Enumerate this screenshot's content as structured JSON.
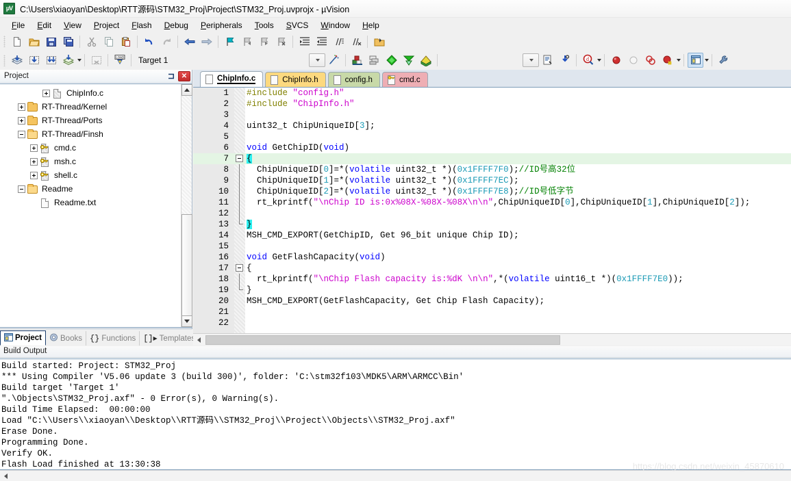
{
  "window": {
    "title": "C:\\Users\\xiaoyan\\Desktop\\RTT源码\\STM32_Proj\\Project\\STM32_Proj.uvprojx - µVision",
    "logo_text": "µV"
  },
  "menubar": {
    "items": [
      {
        "label": "File"
      },
      {
        "label": "Edit"
      },
      {
        "label": "View"
      },
      {
        "label": "Project"
      },
      {
        "label": "Flash"
      },
      {
        "label": "Debug"
      },
      {
        "label": "Peripherals"
      },
      {
        "label": "Tools"
      },
      {
        "label": "SVCS"
      },
      {
        "label": "Window"
      },
      {
        "label": "Help"
      }
    ]
  },
  "toolbar": {
    "target_value": "Target 1",
    "buttons_row1": [
      "new-file-icon",
      "open-file-icon",
      "save-icon",
      "save-all-icon",
      "cut-icon",
      "copy-icon",
      "paste-icon",
      "undo-icon",
      "redo-icon",
      "navigate-back-icon",
      "navigate-forward-icon",
      "bookmark-toggle-icon",
      "bookmark-prev-icon",
      "bookmark-next-icon",
      "bookmark-clear-icon",
      "indent-right-icon",
      "indent-left-icon",
      "comment-icon",
      "uncomment-icon",
      "open-file-folder-icon"
    ],
    "buttons_row2": [
      "translate-icon",
      "build-icon",
      "rebuild-icon",
      "batch-build-icon",
      "stop-build-icon",
      "download-icon"
    ],
    "buttons_row2b": [
      "target-options-icon",
      "manage-components-icon",
      "multi-project-icon",
      "pack-installer-icon",
      "configuration-wizard-icon",
      "pack-manager-icon"
    ],
    "buttons_row3": [
      "insert-bookmark-icon",
      "start-debug-icon",
      "find-in-files-icon",
      "insert-breakpoint-icon",
      "disable-breakpoint-icon",
      "kill-breakpoints-icon",
      "disable-all-breakpoints-icon",
      "window-layout-icon",
      "settings-wrench-icon"
    ]
  },
  "project_panel": {
    "title": "Project",
    "pin_icon": "pin-icon",
    "close_icon": "close-icon",
    "tree": [
      {
        "label": "ChipInfo.c",
        "indent": 3,
        "expander": "plus",
        "icon": "file-hatch"
      },
      {
        "label": "RT-Thread/Kernel",
        "indent": 1,
        "expander": "plus",
        "icon": "folder"
      },
      {
        "label": "RT-Thread/Ports",
        "indent": 1,
        "expander": "plus",
        "icon": "folder"
      },
      {
        "label": "RT-Thread/Finsh",
        "indent": 1,
        "expander": "minus",
        "icon": "folder-open"
      },
      {
        "label": "cmd.c",
        "indent": 2,
        "expander": "plus",
        "icon": "file-key"
      },
      {
        "label": "msh.c",
        "indent": 2,
        "expander": "plus",
        "icon": "file-key"
      },
      {
        "label": "shell.c",
        "indent": 2,
        "expander": "plus",
        "icon": "file-key"
      },
      {
        "label": "Readme",
        "indent": 1,
        "expander": "minus",
        "icon": "folder-open"
      },
      {
        "label": "Readme.txt",
        "indent": 2,
        "expander": "none",
        "icon": "file"
      }
    ],
    "tabs": [
      {
        "label": "Project",
        "icon": "project-icon",
        "active": true
      },
      {
        "label": "Books",
        "icon": "books-icon",
        "active": false
      },
      {
        "label": "Functions",
        "icon": "functions-icon",
        "active": false
      },
      {
        "label": "Templates",
        "icon": "templates-icon",
        "active": false
      }
    ]
  },
  "editor": {
    "tabs": [
      {
        "label": "ChipInfo.c",
        "active": true,
        "color": "#ffffff",
        "icon": "c-file-icon"
      },
      {
        "label": "ChipInfo.h",
        "active": false,
        "color": "#fcd97f",
        "icon": "h-file-icon"
      },
      {
        "label": "config.h",
        "active": false,
        "color": "#c8d9a8",
        "icon": "h-file-icon"
      },
      {
        "label": "cmd.c",
        "active": false,
        "color": "#eeaeb4",
        "icon": "c-key-file-icon"
      }
    ],
    "current_line": 7,
    "lines": [
      {
        "n": 1,
        "fold": "none",
        "tokens": [
          {
            "t": "#include ",
            "c": "pre"
          },
          {
            "t": "\"config.h\"",
            "c": "str"
          }
        ]
      },
      {
        "n": 2,
        "fold": "none",
        "tokens": [
          {
            "t": "#include ",
            "c": "pre"
          },
          {
            "t": "\"ChipInfo.h\"",
            "c": "str"
          }
        ]
      },
      {
        "n": 3,
        "fold": "none",
        "tokens": []
      },
      {
        "n": 4,
        "fold": "none",
        "tokens": [
          {
            "t": "uint32_t ChipUniqueID[",
            "c": "plain"
          },
          {
            "t": "3",
            "c": "num"
          },
          {
            "t": "];",
            "c": "plain"
          }
        ]
      },
      {
        "n": 5,
        "fold": "none",
        "tokens": []
      },
      {
        "n": 6,
        "fold": "none",
        "tokens": [
          {
            "t": "void ",
            "c": "kw"
          },
          {
            "t": "GetChipID(",
            "c": "plain"
          },
          {
            "t": "void",
            "c": "kw"
          },
          {
            "t": ")",
            "c": "plain"
          }
        ]
      },
      {
        "n": 7,
        "fold": "start",
        "tokens": [
          {
            "t": "{",
            "c": "sel"
          }
        ]
      },
      {
        "n": 8,
        "fold": "body",
        "tokens": [
          {
            "t": "  ChipUniqueID[",
            "c": "plain"
          },
          {
            "t": "0",
            "c": "num"
          },
          {
            "t": "]=*(",
            "c": "plain"
          },
          {
            "t": "volatile",
            "c": "kw"
          },
          {
            "t": " uint32_t *)(",
            "c": "plain"
          },
          {
            "t": "0x1FFFF7F0",
            "c": "num"
          },
          {
            "t": ");",
            "c": "plain"
          },
          {
            "t": "//ID号高32位",
            "c": "cmt"
          }
        ]
      },
      {
        "n": 9,
        "fold": "body",
        "tokens": [
          {
            "t": "  ChipUniqueID[",
            "c": "plain"
          },
          {
            "t": "1",
            "c": "num"
          },
          {
            "t": "]=*(",
            "c": "plain"
          },
          {
            "t": "volatile",
            "c": "kw"
          },
          {
            "t": " uint32_t *)(",
            "c": "plain"
          },
          {
            "t": "0x1FFFF7EC",
            "c": "num"
          },
          {
            "t": ");",
            "c": "plain"
          }
        ]
      },
      {
        "n": 10,
        "fold": "body",
        "tokens": [
          {
            "t": "  ChipUniqueID[",
            "c": "plain"
          },
          {
            "t": "2",
            "c": "num"
          },
          {
            "t": "]=*(",
            "c": "plain"
          },
          {
            "t": "volatile",
            "c": "kw"
          },
          {
            "t": " uint32_t *)(",
            "c": "plain"
          },
          {
            "t": "0x1FFFF7E8",
            "c": "num"
          },
          {
            "t": ");",
            "c": "plain"
          },
          {
            "t": "//ID号低字节",
            "c": "cmt"
          }
        ]
      },
      {
        "n": 11,
        "fold": "body",
        "tokens": [
          {
            "t": "  rt_kprintf(",
            "c": "plain"
          },
          {
            "t": "\"\\nChip ID is:0x%08X-%08X-%08X\\n\\n\"",
            "c": "str"
          },
          {
            "t": ",ChipUniqueID[",
            "c": "plain"
          },
          {
            "t": "0",
            "c": "num"
          },
          {
            "t": "],ChipUniqueID[",
            "c": "plain"
          },
          {
            "t": "1",
            "c": "num"
          },
          {
            "t": "],ChipUniqueID[",
            "c": "plain"
          },
          {
            "t": "2",
            "c": "num"
          },
          {
            "t": "]);",
            "c": "plain"
          }
        ]
      },
      {
        "n": 12,
        "fold": "body",
        "tokens": []
      },
      {
        "n": 13,
        "fold": "end",
        "tokens": [
          {
            "t": "}",
            "c": "sel"
          }
        ]
      },
      {
        "n": 14,
        "fold": "none",
        "tokens": [
          {
            "t": "MSH_CMD_EXPORT(GetChipID, Get 96_bit unique Chip ID);",
            "c": "plain"
          }
        ]
      },
      {
        "n": 15,
        "fold": "none",
        "tokens": []
      },
      {
        "n": 16,
        "fold": "none",
        "tokens": [
          {
            "t": "void ",
            "c": "kw"
          },
          {
            "t": "GetFlashCapacity(",
            "c": "plain"
          },
          {
            "t": "void",
            "c": "kw"
          },
          {
            "t": ")",
            "c": "plain"
          }
        ]
      },
      {
        "n": 17,
        "fold": "start",
        "tokens": [
          {
            "t": "{",
            "c": "plain"
          }
        ]
      },
      {
        "n": 18,
        "fold": "body",
        "tokens": [
          {
            "t": "  rt_kprintf(",
            "c": "plain"
          },
          {
            "t": "\"\\nChip Flash capacity is:%dK \\n\\n\"",
            "c": "str"
          },
          {
            "t": ",*(",
            "c": "plain"
          },
          {
            "t": "volatile",
            "c": "kw"
          },
          {
            "t": " uint16_t *)(",
            "c": "plain"
          },
          {
            "t": "0x1FFFF7E0",
            "c": "num"
          },
          {
            "t": "));",
            "c": "plain"
          }
        ]
      },
      {
        "n": 19,
        "fold": "end",
        "tokens": [
          {
            "t": "}",
            "c": "plain"
          }
        ]
      },
      {
        "n": 20,
        "fold": "none",
        "tokens": [
          {
            "t": "MSH_CMD_EXPORT(GetFlashCapacity, Get Chip Flash Capacity);",
            "c": "plain"
          }
        ]
      },
      {
        "n": 21,
        "fold": "none",
        "tokens": []
      },
      {
        "n": 22,
        "fold": "none",
        "tokens": []
      }
    ]
  },
  "build_output": {
    "title": "Build Output",
    "lines": [
      "Build started: Project: STM32_Proj",
      "*** Using Compiler 'V5.06 update 3 (build 300)', folder: 'C:\\stm32f103\\MDK5\\ARM\\ARMCC\\Bin'",
      "Build target 'Target 1'",
      "\".\\Objects\\STM32_Proj.axf\" - 0 Error(s), 0 Warning(s).",
      "Build Time Elapsed:  00:00:00",
      "Load \"C:\\\\Users\\\\xiaoyan\\\\Desktop\\\\RTT源码\\\\STM32_Proj\\\\Project\\\\Objects\\\\STM32_Proj.axf\"",
      "Erase Done.",
      "Programming Done.",
      "Verify OK.",
      "Flash Load finished at 13:30:38"
    ]
  },
  "watermark": {
    "text": "https://blog.csdn.net/weixin_45870610"
  },
  "colors": {
    "keyword": "#0000ff",
    "string": "#cc00cc",
    "comment": "#008000",
    "number": "#1a9ab5",
    "preprocessor": "#808000",
    "selection": "#2cf0f0",
    "current_line": "#e4f5e4"
  }
}
